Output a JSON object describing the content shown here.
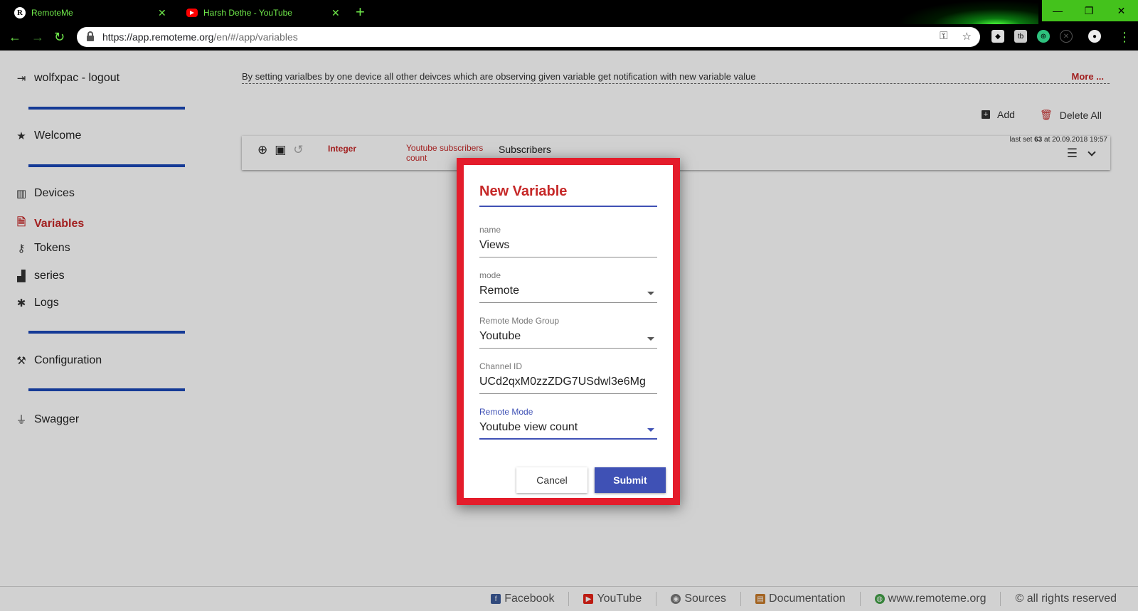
{
  "browser": {
    "tabs": [
      {
        "title": "RemoteMe",
        "favicon": "remoteme-r-icon",
        "active": true
      },
      {
        "title": "Harsh Dethe - YouTube",
        "favicon": "youtube-icon",
        "active": false
      }
    ],
    "url_host": "https://app.remoteme.org",
    "url_path": "/en/#/app/variables",
    "accent_color": "#6fe84a"
  },
  "sidebar": {
    "user": "wolfxpac - logout",
    "items": [
      {
        "label": "Welcome",
        "icon": "star-icon"
      },
      {
        "label": "Devices",
        "icon": "chip-icon"
      },
      {
        "label": "Variables",
        "icon": "variable-file-icon",
        "active": true
      },
      {
        "label": "Tokens",
        "icon": "key-icon"
      },
      {
        "label": "series",
        "icon": "bar-chart-icon"
      },
      {
        "label": "Logs",
        "icon": "bug-icon"
      },
      {
        "label": "Configuration",
        "icon": "wrench-icon"
      },
      {
        "label": "Swagger",
        "icon": "plug-icon"
      }
    ],
    "divider_color": "#1a47b8"
  },
  "main": {
    "info_text": "By setting varialbes by one device all other deivces which are observing given variable get notification with new variable value",
    "more_label": "More ...",
    "add_label": "Add",
    "delete_all_label": "Delete All",
    "variable_row": {
      "type": "Integer",
      "mode": "Youtube subscribers count",
      "name": "Subscribers",
      "last_set_prefix": "last set",
      "last_set_value": "63",
      "last_set_suffix": "at 20.09.2018 19:57"
    }
  },
  "dialog": {
    "title": "New Variable",
    "fields": {
      "name": {
        "label": "name",
        "value": "Views"
      },
      "mode": {
        "label": "mode",
        "value": "Remote"
      },
      "group": {
        "label": "Remote Mode Group",
        "value": "Youtube"
      },
      "channel": {
        "label": "Channel ID",
        "value": "UCd2qxM0zzZDG7USdwl3e6Mg"
      },
      "remote_mode": {
        "label": "Remote Mode",
        "value": "Youtube view count"
      }
    },
    "cancel_label": "Cancel",
    "submit_label": "Submit",
    "highlight_color": "#e41c2b",
    "primary_color": "#3f51b5"
  },
  "footer": {
    "links": [
      {
        "label": "Facebook",
        "icon": "facebook-icon"
      },
      {
        "label": "YouTube",
        "icon": "youtube-icon"
      },
      {
        "label": "Sources",
        "icon": "github-icon"
      },
      {
        "label": "Documentation",
        "icon": "book-icon"
      },
      {
        "label": "www.remoteme.org",
        "icon": "globe-icon"
      },
      {
        "label": "© all rights reserved",
        "icon": ""
      }
    ]
  }
}
